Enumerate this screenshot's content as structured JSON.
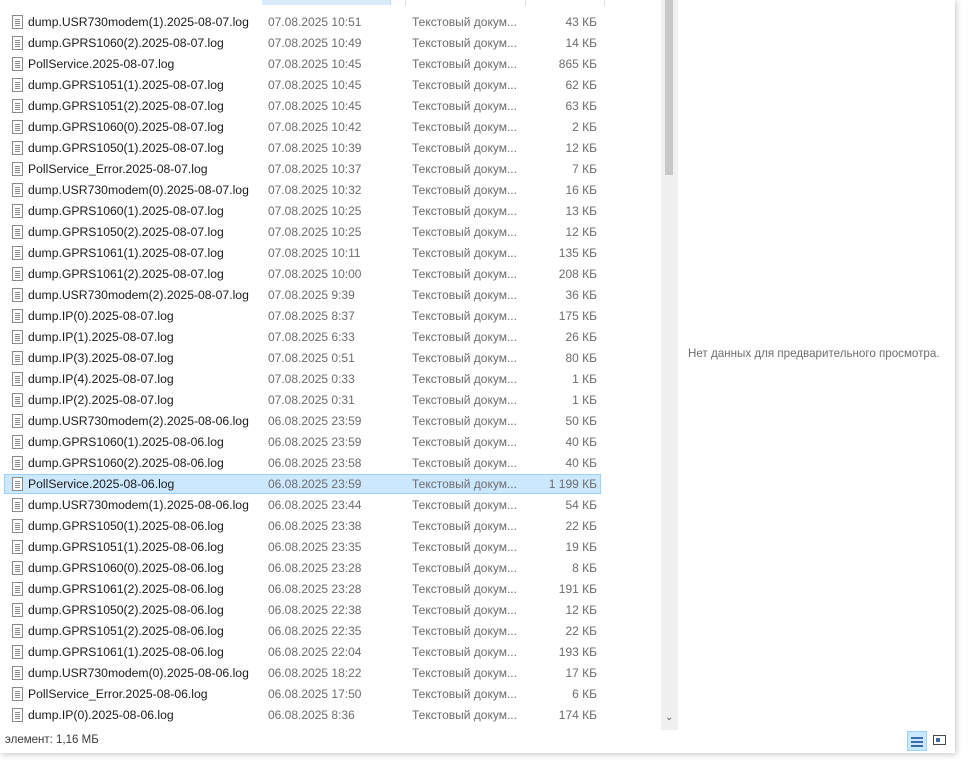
{
  "files": [
    {
      "name": "dump.USR730modem(1).2025-08-07.log",
      "date": "07.08.2025 10:51",
      "type": "Текстовый докум...",
      "size": "43 КБ"
    },
    {
      "name": "dump.GPRS1060(2).2025-08-07.log",
      "date": "07.08.2025 10:49",
      "type": "Текстовый докум...",
      "size": "14 КБ"
    },
    {
      "name": "PollService.2025-08-07.log",
      "date": "07.08.2025 10:45",
      "type": "Текстовый докум...",
      "size": "865 КБ"
    },
    {
      "name": "dump.GPRS1051(1).2025-08-07.log",
      "date": "07.08.2025 10:45",
      "type": "Текстовый докум...",
      "size": "62 КБ"
    },
    {
      "name": "dump.GPRS1051(2).2025-08-07.log",
      "date": "07.08.2025 10:45",
      "type": "Текстовый докум...",
      "size": "63 КБ"
    },
    {
      "name": "dump.GPRS1060(0).2025-08-07.log",
      "date": "07.08.2025 10:42",
      "type": "Текстовый докум...",
      "size": "2 КБ"
    },
    {
      "name": "dump.GPRS1050(1).2025-08-07.log",
      "date": "07.08.2025 10:39",
      "type": "Текстовый докум...",
      "size": "12 КБ"
    },
    {
      "name": "PollService_Error.2025-08-07.log",
      "date": "07.08.2025 10:37",
      "type": "Текстовый докум...",
      "size": "7 КБ"
    },
    {
      "name": "dump.USR730modem(0).2025-08-07.log",
      "date": "07.08.2025 10:32",
      "type": "Текстовый докум...",
      "size": "16 КБ"
    },
    {
      "name": "dump.GPRS1060(1).2025-08-07.log",
      "date": "07.08.2025 10:25",
      "type": "Текстовый докум...",
      "size": "13 КБ"
    },
    {
      "name": "dump.GPRS1050(2).2025-08-07.log",
      "date": "07.08.2025 10:25",
      "type": "Текстовый докум...",
      "size": "12 КБ"
    },
    {
      "name": "dump.GPRS1061(1).2025-08-07.log",
      "date": "07.08.2025 10:11",
      "type": "Текстовый докум...",
      "size": "135 КБ"
    },
    {
      "name": "dump.GPRS1061(2).2025-08-07.log",
      "date": "07.08.2025 10:00",
      "type": "Текстовый докум...",
      "size": "208 КБ"
    },
    {
      "name": "dump.USR730modem(2).2025-08-07.log",
      "date": "07.08.2025 9:39",
      "type": "Текстовый докум...",
      "size": "36 КБ"
    },
    {
      "name": "dump.IP(0).2025-08-07.log",
      "date": "07.08.2025 8:37",
      "type": "Текстовый докум...",
      "size": "175 КБ"
    },
    {
      "name": "dump.IP(1).2025-08-07.log",
      "date": "07.08.2025 6:33",
      "type": "Текстовый докум...",
      "size": "26 КБ"
    },
    {
      "name": "dump.IP(3).2025-08-07.log",
      "date": "07.08.2025 0:51",
      "type": "Текстовый докум...",
      "size": "80 КБ"
    },
    {
      "name": "dump.IP(4).2025-08-07.log",
      "date": "07.08.2025 0:33",
      "type": "Текстовый докум...",
      "size": "1 КБ"
    },
    {
      "name": "dump.IP(2).2025-08-07.log",
      "date": "07.08.2025 0:31",
      "type": "Текстовый докум...",
      "size": "1 КБ"
    },
    {
      "name": "dump.USR730modem(2).2025-08-06.log",
      "date": "06.08.2025 23:59",
      "type": "Текстовый докум...",
      "size": "50 КБ"
    },
    {
      "name": "dump.GPRS1060(1).2025-08-06.log",
      "date": "06.08.2025 23:59",
      "type": "Текстовый докум...",
      "size": "40 КБ"
    },
    {
      "name": "dump.GPRS1060(2).2025-08-06.log",
      "date": "06.08.2025 23:58",
      "type": "Текстовый докум...",
      "size": "40 КБ"
    },
    {
      "name": "PollService.2025-08-06.log",
      "date": "06.08.2025 23:59",
      "type": "Текстовый докум...",
      "size": "1 199 КБ",
      "selected": true
    },
    {
      "name": "dump.USR730modem(1).2025-08-06.log",
      "date": "06.08.2025 23:44",
      "type": "Текстовый докум...",
      "size": "54 КБ"
    },
    {
      "name": "dump.GPRS1050(1).2025-08-06.log",
      "date": "06.08.2025 23:38",
      "type": "Текстовый докум...",
      "size": "22 КБ"
    },
    {
      "name": "dump.GPRS1051(1).2025-08-06.log",
      "date": "06.08.2025 23:35",
      "type": "Текстовый докум...",
      "size": "19 КБ"
    },
    {
      "name": "dump.GPRS1060(0).2025-08-06.log",
      "date": "06.08.2025 23:28",
      "type": "Текстовый докум...",
      "size": "8 КБ"
    },
    {
      "name": "dump.GPRS1061(2).2025-08-06.log",
      "date": "06.08.2025 23:28",
      "type": "Текстовый докум...",
      "size": "191 КБ"
    },
    {
      "name": "dump.GPRS1050(2).2025-08-06.log",
      "date": "06.08.2025 22:38",
      "type": "Текстовый докум...",
      "size": "12 КБ"
    },
    {
      "name": "dump.GPRS1051(2).2025-08-06.log",
      "date": "06.08.2025 22:35",
      "type": "Текстовый докум...",
      "size": "22 КБ"
    },
    {
      "name": "dump.GPRS1061(1).2025-08-06.log",
      "date": "06.08.2025 22:04",
      "type": "Текстовый докум...",
      "size": "193 КБ"
    },
    {
      "name": "dump.USR730modem(0).2025-08-06.log",
      "date": "06.08.2025 18:22",
      "type": "Текстовый докум...",
      "size": "17 КБ"
    },
    {
      "name": "PollService_Error.2025-08-06.log",
      "date": "06.08.2025 17:50",
      "type": "Текстовый докум...",
      "size": "6 КБ"
    },
    {
      "name": "dump.IP(0).2025-08-06.log",
      "date": "06.08.2025 8:36",
      "type": "Текстовый докум...",
      "size": "174 КБ"
    }
  ],
  "icons": {
    "file": "text-file-icon",
    "scroll_down": "chevron-down-icon",
    "details_view": "details-view-icon",
    "large_icons_view": "large-icons-view-icon"
  },
  "preview": {
    "message": "Нет данных для предварительного просмотра."
  },
  "status": {
    "text": "элемент: 1,16 МБ"
  },
  "colors": {
    "selection_bg": "#cce8ff",
    "selection_border": "#99d1ff",
    "secondary_text": "#6d6d6d"
  }
}
